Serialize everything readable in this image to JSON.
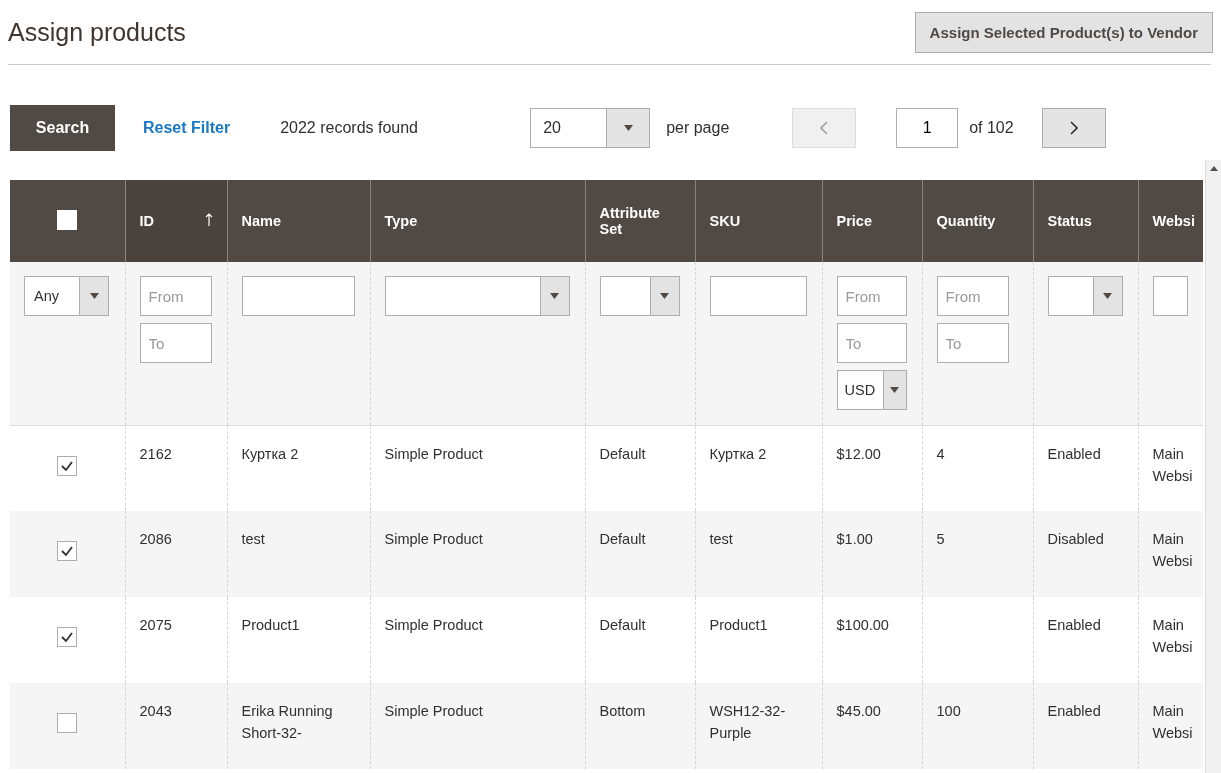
{
  "page_title": "Assign products",
  "assign_button": "Assign Selected Product(s) to Vendor",
  "toolbar": {
    "search_button": "Search",
    "reset_link": "Reset Filter",
    "records": "2022 records found",
    "per_page": {
      "value": "20",
      "label": "per page"
    },
    "pager": {
      "prev_disabled": true,
      "page": "1",
      "of": "of 102",
      "next_disabled": false
    }
  },
  "table": {
    "select_all": {
      "checked": false
    },
    "columns": [
      {
        "label": "ID",
        "sorted": true
      },
      {
        "label": "Name",
        "sorted": false
      },
      {
        "label": "Type",
        "sorted": false
      },
      {
        "label": "Attribute Set",
        "sorted": false
      },
      {
        "label": "SKU",
        "sorted": false
      },
      {
        "label": "Price",
        "sorted": false
      },
      {
        "label": "Quantity",
        "sorted": false
      },
      {
        "label": "Status",
        "sorted": false
      },
      {
        "label": "Websi",
        "sorted": false
      }
    ],
    "filters": [
      {
        "kind": "select",
        "value": "Any"
      },
      {
        "kind": "range",
        "placeholder_from": "From",
        "placeholder_to": "To"
      },
      {
        "kind": "text"
      },
      {
        "kind": "select"
      },
      {
        "kind": "select"
      },
      {
        "kind": "text"
      },
      {
        "kind": "range",
        "placeholder_from": "From",
        "placeholder_to": "To",
        "currency": "USD"
      },
      {
        "kind": "range",
        "placeholder_from": "From",
        "placeholder_to": "To"
      },
      {
        "kind": "select"
      },
      {
        "kind": "text"
      }
    ],
    "rows": [
      {
        "checked": true,
        "cells": [
          "2162",
          "Куртка 2",
          "Simple Product",
          "Default",
          "Куртка 2",
          "$12.00",
          "4",
          "Enabled",
          "Main Websi"
        ]
      },
      {
        "checked": true,
        "cells": [
          "2086",
          "test",
          "Simple Product",
          "Default",
          "test",
          "$1.00",
          "5",
          "Disabled",
          "Main Websi"
        ]
      },
      {
        "checked": true,
        "cells": [
          "2075",
          "Product1",
          "Simple Product",
          "Default",
          "Product1",
          "$100.00",
          "",
          "Enabled",
          "Main Websi"
        ]
      },
      {
        "checked": false,
        "cells": [
          "2043",
          "Erika Running Short-32-",
          "Simple Product",
          "Bottom",
          "WSH12-32-Purple",
          "$45.00",
          "100",
          "Enabled",
          "Main Websi"
        ]
      }
    ]
  }
}
